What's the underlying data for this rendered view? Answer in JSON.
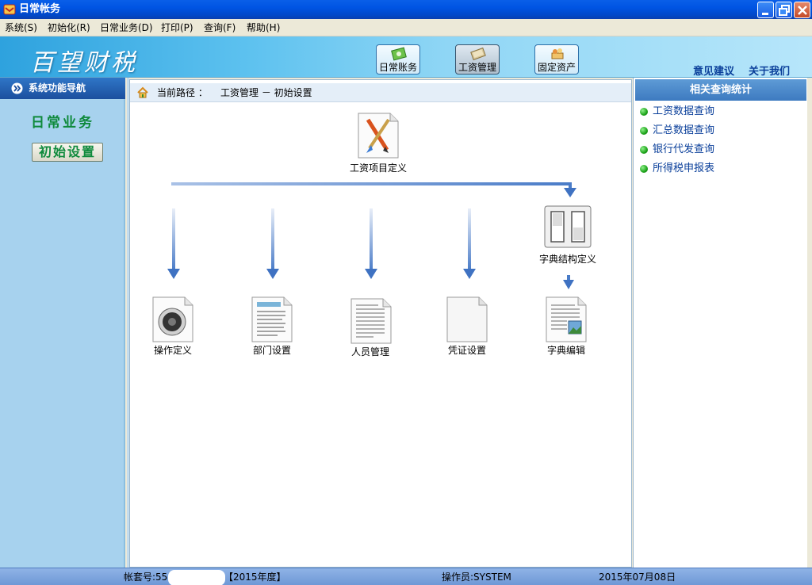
{
  "window": {
    "title": "日常帐务"
  },
  "menu": {
    "items": [
      "系统(S)",
      "初始化(R)",
      "日常业务(D)",
      "打印(P)",
      "查询(F)",
      "帮助(H)"
    ]
  },
  "banner": {
    "logo": "百望财税",
    "modules": [
      {
        "label": "日常账务",
        "icon": "ledger-icon",
        "active": false
      },
      {
        "label": "工资管理",
        "icon": "money-icon",
        "active": true
      },
      {
        "label": "固定资产",
        "icon": "assets-icon",
        "active": false
      }
    ],
    "links": [
      "意见建议",
      "关于我们"
    ]
  },
  "leftnav": {
    "header": "系统功能导航",
    "section": "日常业务",
    "button": "初始设置"
  },
  "main": {
    "path_label": "当前路径 ：",
    "path_value": "工资管理 － 初始设置",
    "flow": {
      "top": {
        "label": "工资项目定义",
        "icon": "brush-pencil-icon"
      },
      "dictionary_structure": {
        "label": "字典结构定义",
        "icon": "toggle-switches-icon"
      },
      "items": [
        {
          "label": "操作定义",
          "icon": "speaker-icon"
        },
        {
          "label": "部门设置",
          "icon": "document-icon"
        },
        {
          "label": "人员管理",
          "icon": "text-document-icon"
        },
        {
          "label": "凭证设置",
          "icon": "blank-page-icon"
        },
        {
          "label": "字典编辑",
          "icon": "image-document-icon"
        }
      ]
    }
  },
  "rightpanel": {
    "header": "相关查询统计",
    "links": [
      "工资数据查询",
      "汇总数据查询",
      "银行代发查询",
      "所得税申报表"
    ]
  },
  "status": {
    "account_label": "帐套号:55",
    "year": "【2015年度】",
    "operator": "操作员:SYSTEM",
    "date": "2015年07月08日"
  },
  "colors": {
    "titlebar": "#0054e3",
    "nav_green": "#0f8a3c",
    "link_blue": "#0a3f9a",
    "flow_arrow": "#3f72c2"
  }
}
